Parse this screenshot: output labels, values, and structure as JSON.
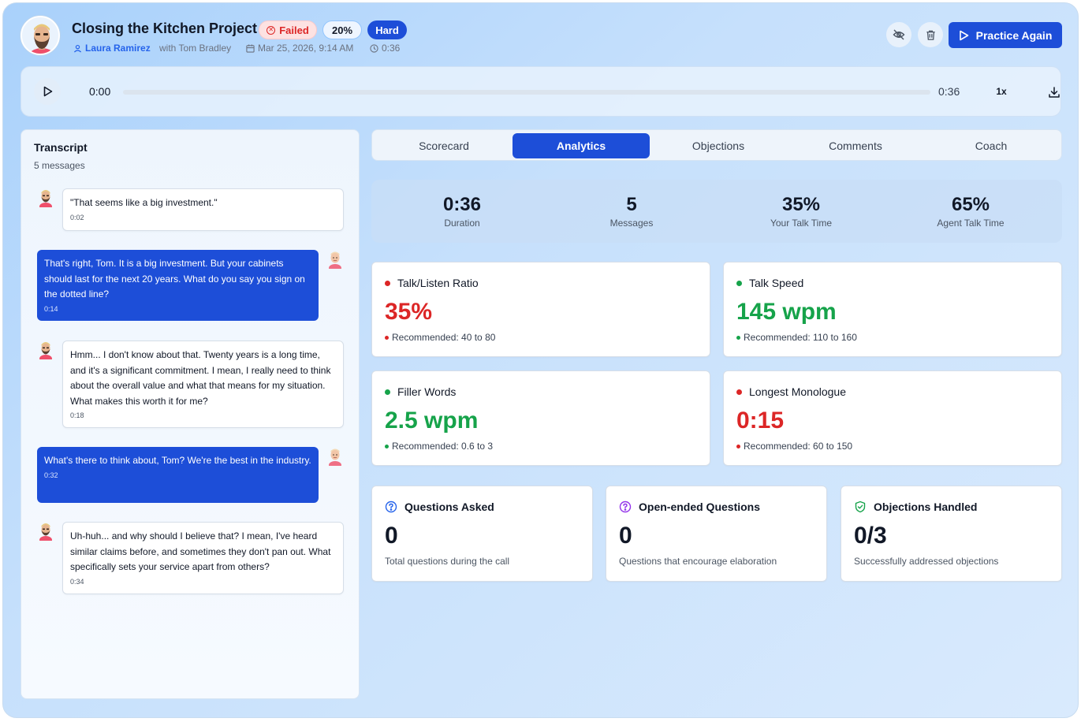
{
  "header": {
    "title": "Closing the Kitchen Project",
    "status_badge": "Failed",
    "score_badge": "20%",
    "difficulty_badge": "Hard",
    "user_name": "Laura Ramirez",
    "with_text": "with Tom Bradley",
    "date": "Mar 25, 2026, 9:14 AM",
    "duration": "0:36",
    "practice_button": "Practice Again"
  },
  "player": {
    "current_time": "0:00",
    "total_time": "0:36",
    "progress": 0,
    "speed": "1x"
  },
  "transcript": {
    "title": "Transcript",
    "count": "5 messages",
    "messages": [
      {
        "role": "prospect",
        "text": "\"That seems like a big investment.\"",
        "time": "0:02"
      },
      {
        "role": "agent",
        "text": "That's right, Tom. It is a big investment. But your cabinets should last for the next 20 years. What do you say you sign on the dotted line?",
        "time": "0:14"
      },
      {
        "role": "prospect",
        "text": "Hmm... I don't know about that. Twenty years is a long time, and it's a significant commitment. I mean, I really need to think about the overall value and what that means for my situation. What makes this worth it for me?",
        "time": "0:18"
      },
      {
        "role": "agent",
        "text": "What's there to think about, Tom? We're the best in the industry.",
        "time": "0:32"
      },
      {
        "role": "prospect",
        "text": "Uh-huh... and why should I believe that? I mean, I've heard similar claims before, and sometimes they don't pan out. What specifically sets your service apart from others?",
        "time": "0:34"
      }
    ]
  },
  "tabs": [
    {
      "label": "Scorecard",
      "active": false
    },
    {
      "label": "Analytics",
      "active": true
    },
    {
      "label": "Objections",
      "active": false
    },
    {
      "label": "Comments",
      "active": false
    },
    {
      "label": "Coach",
      "active": false
    }
  ],
  "stats": [
    {
      "value": "0:36",
      "label": "Duration"
    },
    {
      "value": "5",
      "label": "Messages"
    },
    {
      "value": "35%",
      "label": "Your Talk Time"
    },
    {
      "value": "65%",
      "label": "Agent Talk Time"
    }
  ],
  "metrics": [
    {
      "title": "Talk/Listen Ratio",
      "value": "35%",
      "recommended": "Recommended: 40 to 80",
      "status": "red"
    },
    {
      "title": "Talk Speed",
      "value": "145 wpm",
      "recommended": "Recommended: 110 to 160",
      "status": "green"
    },
    {
      "title": "Filler Words",
      "value": "2.5 wpm",
      "recommended": "Recommended: 0.6 to 3",
      "status": "green"
    },
    {
      "title": "Longest Monologue",
      "value": "0:15",
      "recommended": "Recommended: 60 to 150",
      "status": "red"
    }
  ],
  "question_cards": [
    {
      "title": "Questions Asked",
      "value": "0",
      "desc": "Total questions during the call",
      "icon": "question-circle-icon",
      "color": "#2563eb"
    },
    {
      "title": "Open-ended Questions",
      "value": "0",
      "desc": "Questions that encourage elaboration",
      "icon": "question-circle-icon",
      "color": "#9333ea"
    },
    {
      "title": "Objections Handled",
      "value": "0/3",
      "desc": "Successfully addressed objections",
      "icon": "shield-check-icon",
      "color": "#16a34a"
    }
  ],
  "colors": {
    "primary": "#1d4ed8",
    "danger": "#dc2626",
    "success": "#16a34a"
  }
}
